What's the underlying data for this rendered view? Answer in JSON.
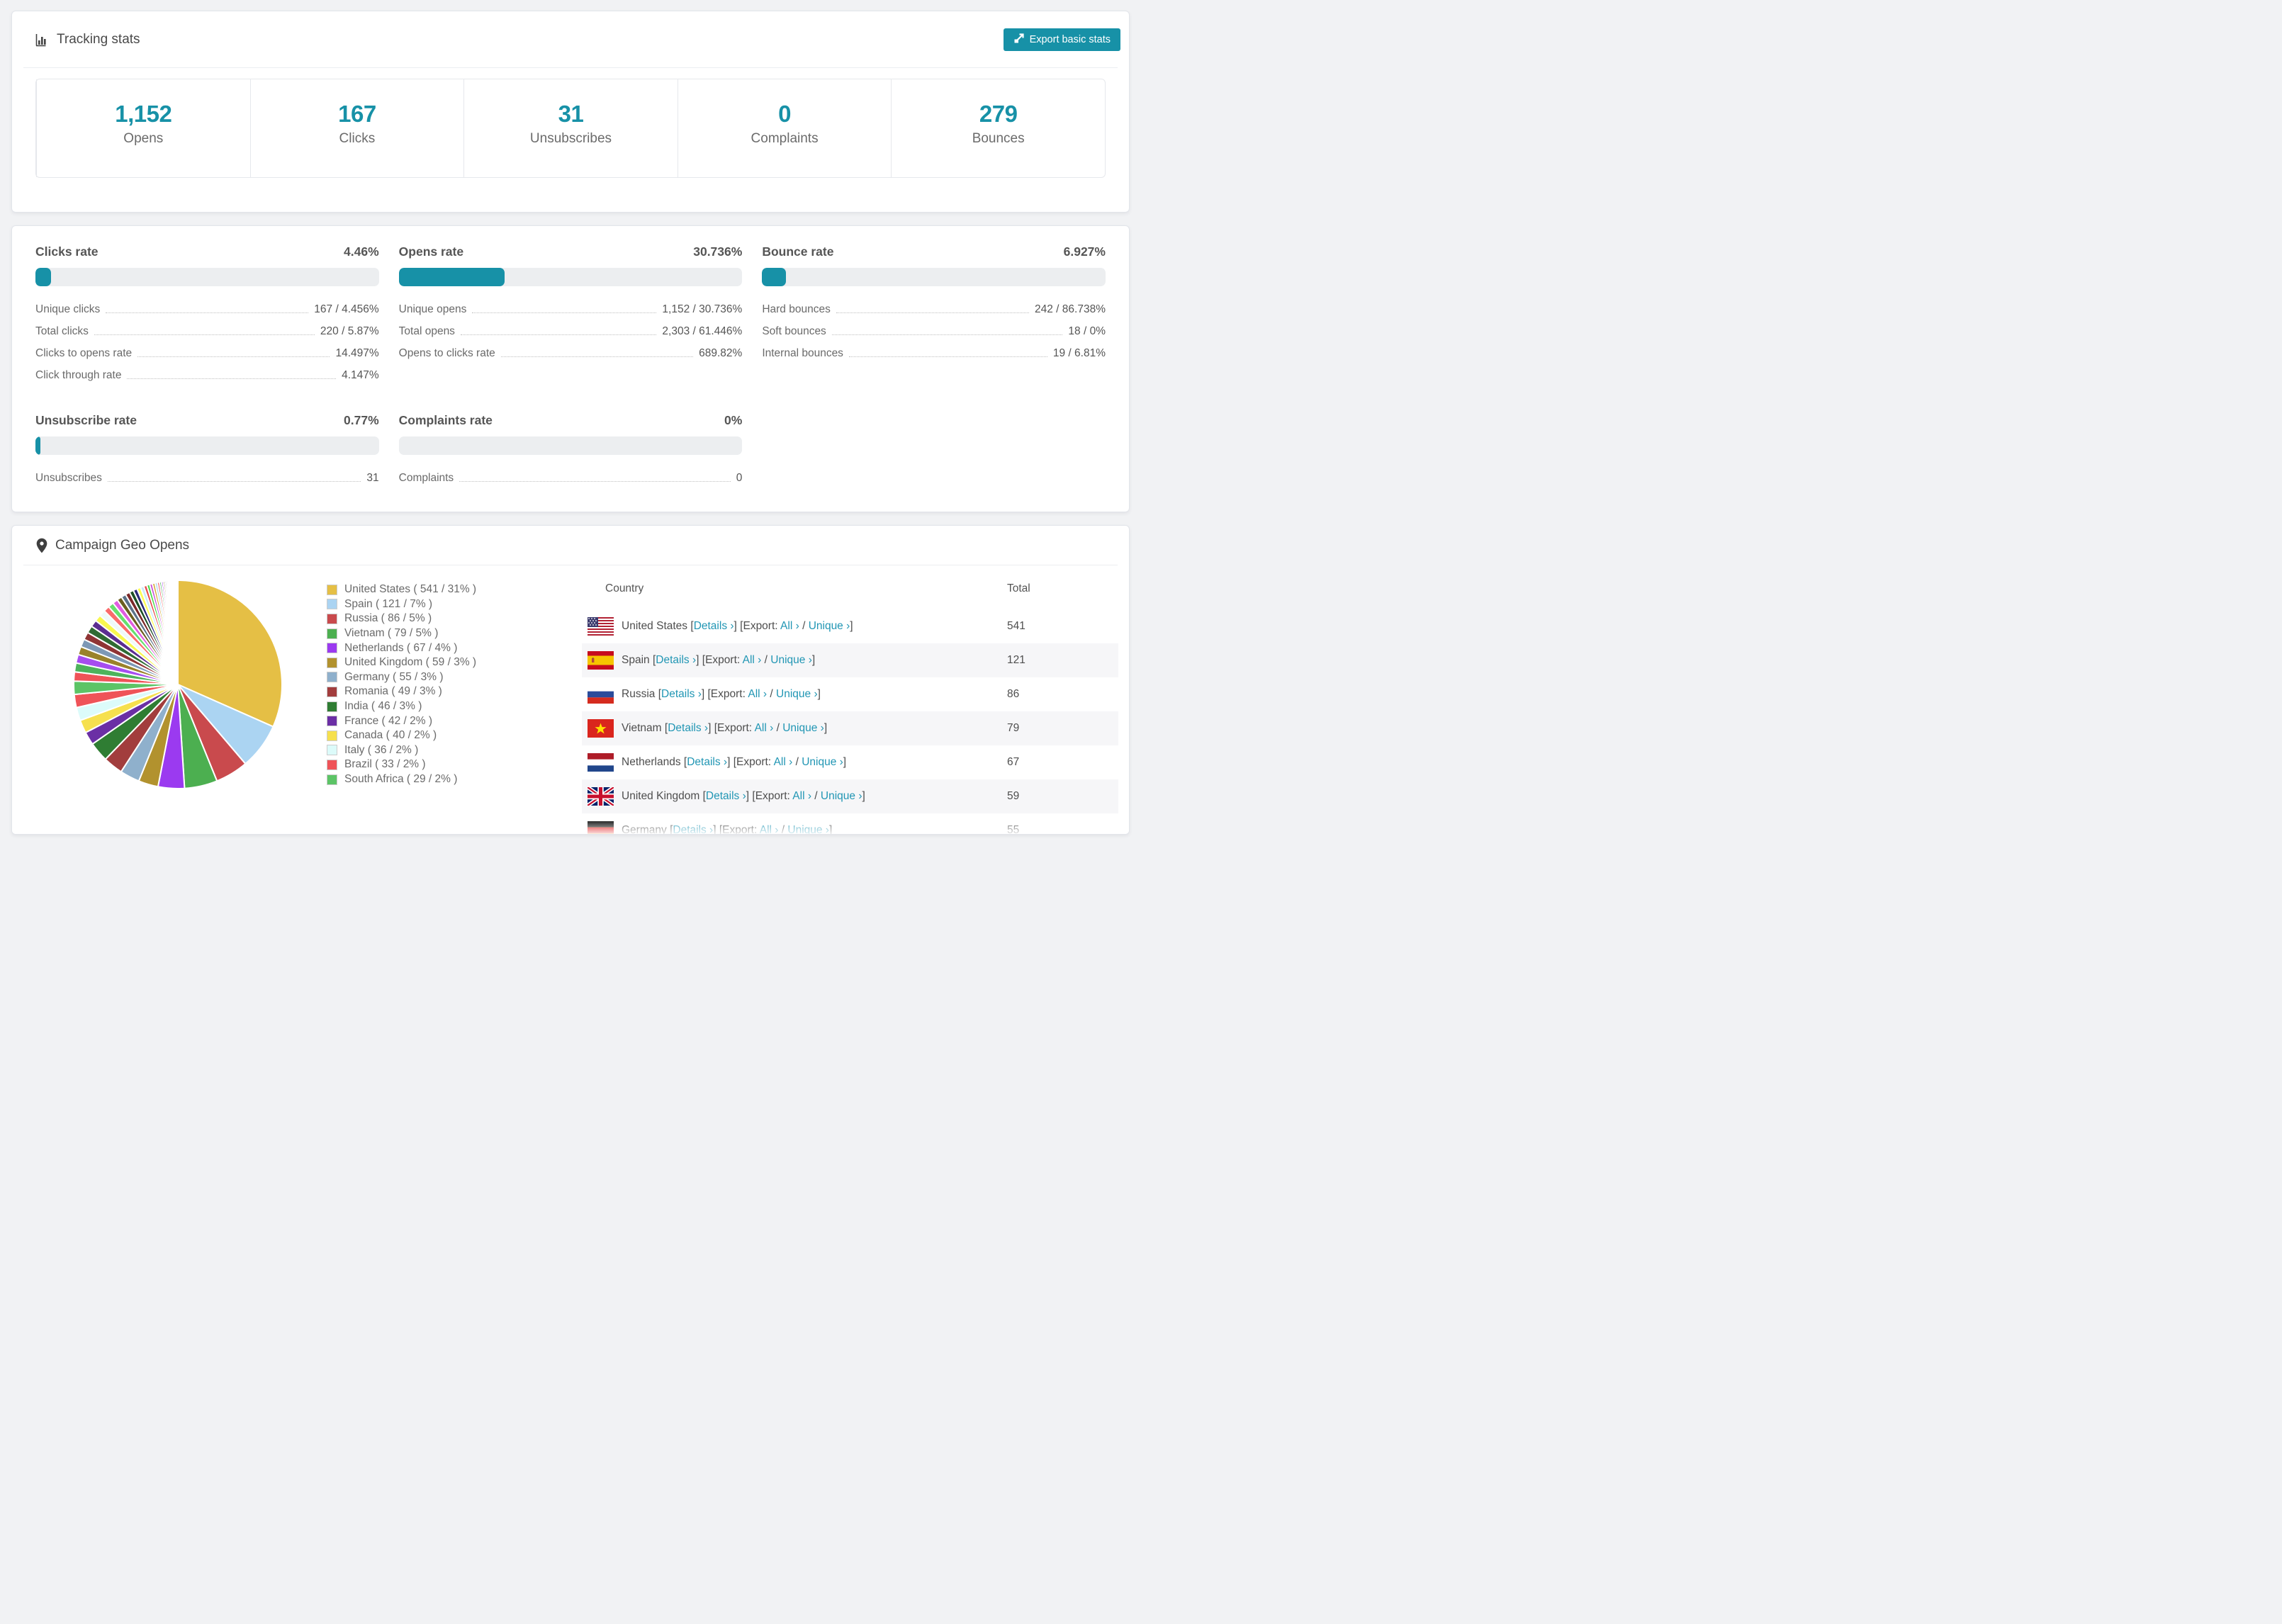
{
  "theme": {
    "accent": "#1791a7",
    "link": "#2196b4",
    "page_bg": "#f1f2f4"
  },
  "tracking": {
    "title": "Tracking stats",
    "export_button": "Export basic stats",
    "stats": [
      {
        "value": "1,152",
        "label": "Opens"
      },
      {
        "value": "167",
        "label": "Clicks"
      },
      {
        "value": "31",
        "label": "Unsubscribes"
      },
      {
        "value": "0",
        "label": "Complaints"
      },
      {
        "value": "279",
        "label": "Bounces"
      }
    ]
  },
  "rates": {
    "sections": [
      {
        "title": "Clicks rate",
        "value": "4.46%",
        "percent": 4.46,
        "rows": [
          {
            "label": "Unique clicks",
            "value": "167 / 4.456%"
          },
          {
            "label": "Total clicks",
            "value": "220 / 5.87%"
          },
          {
            "label": "Clicks to opens rate",
            "value": "14.497%"
          },
          {
            "label": "Click through rate",
            "value": "4.147%"
          }
        ]
      },
      {
        "title": "Opens rate",
        "value": "30.736%",
        "percent": 30.736,
        "rows": [
          {
            "label": "Unique opens",
            "value": "1,152 / 30.736%"
          },
          {
            "label": "Total opens",
            "value": "2,303 / 61.446%"
          },
          {
            "label": "Opens to clicks rate",
            "value": "689.82%"
          }
        ]
      },
      {
        "title": "Bounce rate",
        "value": "6.927%",
        "percent": 6.927,
        "rows": [
          {
            "label": "Hard bounces",
            "value": "242 / 86.738%"
          },
          {
            "label": "Soft bounces",
            "value": "18 / 0%"
          },
          {
            "label": "Internal bounces",
            "value": "19 / 6.81%"
          }
        ]
      },
      {
        "title": "Unsubscribe rate",
        "value": "0.77%",
        "percent": 0.77,
        "rows": [
          {
            "label": "Unsubscribes",
            "value": "31"
          }
        ]
      },
      {
        "title": "Complaints rate",
        "value": "0%",
        "percent": 0,
        "rows": [
          {
            "label": "Complaints",
            "value": "0"
          }
        ]
      }
    ]
  },
  "geo": {
    "title": "Campaign Geo Opens",
    "columns": {
      "country": "Country",
      "total": "Total"
    },
    "links": {
      "details": "Details ›",
      "export": "[Export:",
      "all": "All ›",
      "slash": "/",
      "unique": "Unique ›",
      "open": "[",
      "close": "]",
      "close2": "]"
    },
    "rows": [
      {
        "country": "United States",
        "total": "541",
        "flag": "us"
      },
      {
        "country": "Spain",
        "total": "121",
        "flag": "es"
      },
      {
        "country": "Russia",
        "total": "86",
        "flag": "ru"
      },
      {
        "country": "Vietnam",
        "total": "79",
        "flag": "vn"
      },
      {
        "country": "Netherlands",
        "total": "67",
        "flag": "nl"
      },
      {
        "country": "United Kingdom",
        "total": "59",
        "flag": "gb"
      },
      {
        "country": "Germany",
        "total": "55",
        "flag": "de"
      }
    ]
  },
  "chart_data": {
    "type": "pie",
    "title": "Campaign Geo Opens",
    "legend_position": "right",
    "series": [
      {
        "name": "United States",
        "count": 541,
        "pct": 31,
        "color": "#e5bf45",
        "label": "United States ( 541 / 31% )"
      },
      {
        "name": "Spain",
        "count": 121,
        "pct": 7,
        "color": "#abd4f2",
        "label": "Spain ( 121 / 7% )"
      },
      {
        "name": "Russia",
        "count": 86,
        "pct": 5,
        "color": "#c94a4d",
        "label": "Russia ( 86 / 5% )"
      },
      {
        "name": "Vietnam",
        "count": 79,
        "pct": 5,
        "color": "#4caf50",
        "label": "Vietnam ( 79 / 5% )"
      },
      {
        "name": "Netherlands",
        "count": 67,
        "pct": 4,
        "color": "#9b3af0",
        "label": "Netherlands ( 67 / 4% )"
      },
      {
        "name": "United Kingdom",
        "count": 59,
        "pct": 3,
        "color": "#b2922e",
        "label": "United Kingdom ( 59 / 3% )"
      },
      {
        "name": "Germany",
        "count": 55,
        "pct": 3,
        "color": "#8fb0cc",
        "label": "Germany ( 55 / 3% )"
      },
      {
        "name": "Romania",
        "count": 49,
        "pct": 3,
        "color": "#a23d3d",
        "label": "Romania ( 49 / 3% )"
      },
      {
        "name": "India",
        "count": 46,
        "pct": 3,
        "color": "#2f7d33",
        "label": "India ( 46 / 3% )"
      },
      {
        "name": "France",
        "count": 42,
        "pct": 2,
        "color": "#6b2fa5",
        "label": "France ( 42 / 2% )"
      },
      {
        "name": "Canada",
        "count": 40,
        "pct": 2,
        "color": "#f6e04e",
        "label": "Canada ( 40 / 2% )"
      },
      {
        "name": "Italy",
        "count": 36,
        "pct": 2,
        "color": "#dcfbfa",
        "label": "Italy ( 36 / 2% )"
      },
      {
        "name": "Brazil",
        "count": 33,
        "pct": 2,
        "color": "#ef5358",
        "label": "Brazil ( 33 / 2% )"
      },
      {
        "name": "South Africa",
        "count": 29,
        "pct": 2,
        "color": "#5cc466",
        "label": "South Africa ( 29 / 2% )"
      }
    ],
    "other_slices_values": [
      1.4,
      1.35,
      1.3,
      1.25,
      1.2,
      1.15,
      1.1,
      1.05,
      1.0,
      0.95,
      0.9,
      0.85,
      0.8,
      0.76,
      0.72,
      0.68,
      0.64,
      0.6,
      0.56,
      0.52,
      0.48,
      0.45,
      0.42,
      0.39,
      0.36,
      0.33,
      0.3,
      0.28,
      0.26,
      0.24,
      0.22,
      0.2,
      0.18,
      0.16,
      0.14,
      0.12,
      0.11,
      0.1,
      0.09,
      0.08,
      0.07,
      0.06,
      0.05,
      0.05,
      0.04,
      0.04
    ],
    "other_palette": [
      "#ef5358",
      "#4db35c",
      "#a64df0",
      "#9a822a",
      "#7d98b5",
      "#8f3434",
      "#2f6b33",
      "#5b2d91",
      "#f8f84f",
      "#eefafa",
      "#fa6b6b",
      "#66e06e",
      "#e05ce0",
      "#6b5e1f",
      "#5c7288",
      "#7a2828",
      "#1d4f24",
      "#2a2a78",
      "#fdfd55",
      "#c9e8fa",
      "#e84848",
      "#49d849",
      "#c84dd8",
      "#d4a62e",
      "#a7d3f0"
    ]
  }
}
